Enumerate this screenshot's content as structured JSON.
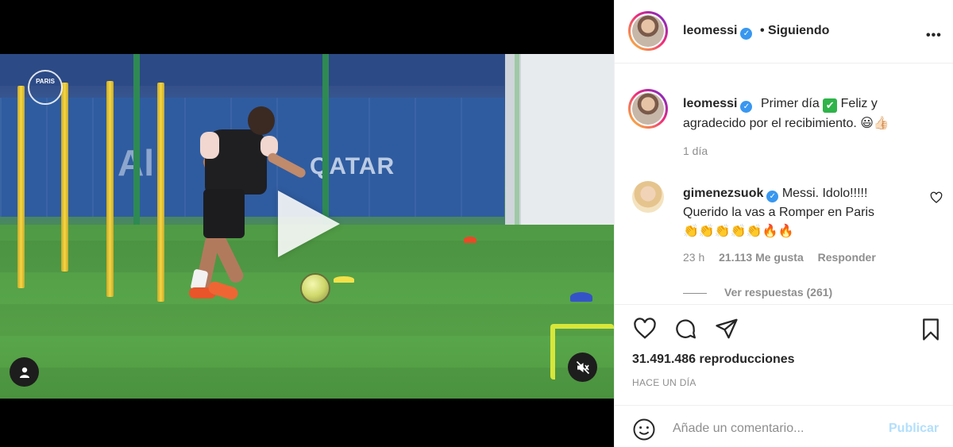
{
  "post": {
    "username": "leomessi",
    "follow_status": "• Siguiendo",
    "more_label": "•••"
  },
  "caption": {
    "username": "leomessi",
    "text_before_check": "Primer día",
    "check_glyph": "✔",
    "text_after_check": "Feliz y agradecido por el recibimiento.",
    "emojis": "😃👍🏻",
    "time": "1 día"
  },
  "comment": {
    "username": "gimenezsuok",
    "text": "Messi. Idolo!!!!! Querido la vas a Romper en Paris",
    "emojis": "👏👏👏👏👏🔥🔥",
    "time": "23 h",
    "likes": "21.113 Me gusta",
    "reply_label": "Responder",
    "view_replies": "Ver respuestas (261)"
  },
  "stats": {
    "views": "31.491.486 reproducciones",
    "posted_ago": "HACE UN DÍA"
  },
  "add_comment": {
    "placeholder": "Añade un comentario...",
    "publish_label": "Publicar"
  },
  "video": {
    "sponsor_text": "QATAR",
    "logo_text": "PARIS",
    "brand_text": "Al"
  },
  "colors": {
    "verified": "#3897f0",
    "publish_disabled": "#b2dffc",
    "check": "#2fb34a"
  },
  "icons": [
    "play-icon",
    "user-tag-icon",
    "mute-icon",
    "verified-icon",
    "more-icon",
    "heart-icon",
    "comment-icon",
    "share-icon",
    "save-icon",
    "emoji-icon"
  ]
}
